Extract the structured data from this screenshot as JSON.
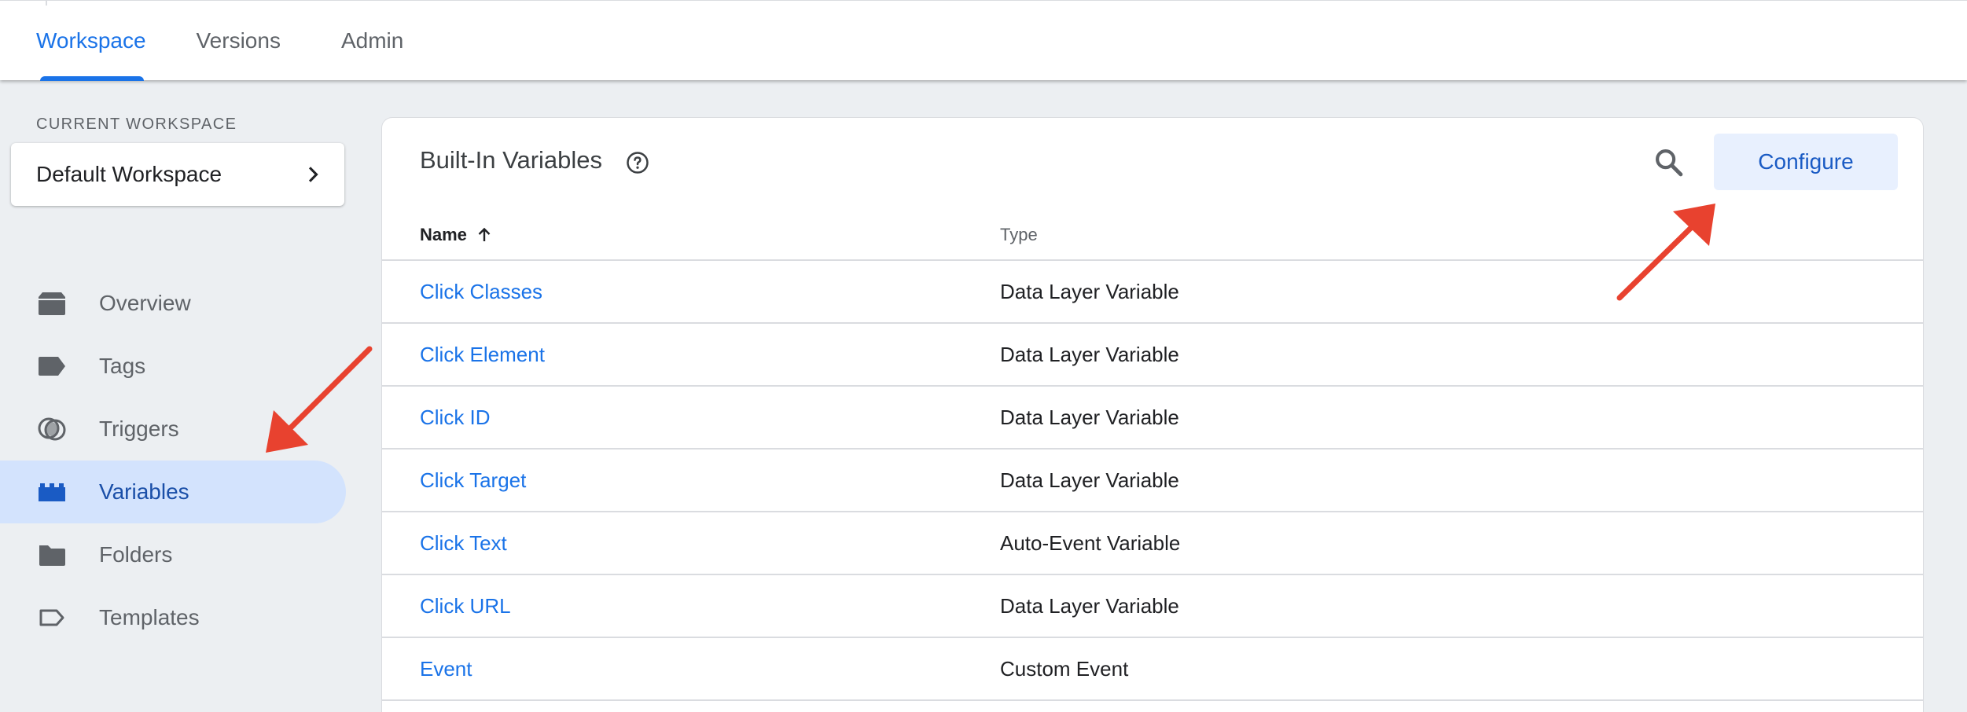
{
  "tabs": [
    {
      "label": "Workspace",
      "active": true
    },
    {
      "label": "Versions",
      "active": false
    },
    {
      "label": "Admin",
      "active": false
    }
  ],
  "sidebar": {
    "current_workspace_label": "CURRENT WORKSPACE",
    "workspace_name": "Default Workspace",
    "nav": [
      {
        "label": "Overview",
        "icon": "overview-icon",
        "active": false
      },
      {
        "label": "Tags",
        "icon": "tag-icon",
        "active": false
      },
      {
        "label": "Triggers",
        "icon": "triggers-icon",
        "active": false
      },
      {
        "label": "Variables",
        "icon": "variables-icon",
        "active": true
      },
      {
        "label": "Folders",
        "icon": "folder-icon",
        "active": false
      },
      {
        "label": "Templates",
        "icon": "templates-icon",
        "active": false
      }
    ]
  },
  "main": {
    "title": "Built-In Variables",
    "configure_label": "Configure",
    "columns": {
      "name": "Name",
      "type": "Type"
    },
    "rows": [
      {
        "name": "Click Classes",
        "type": "Data Layer Variable"
      },
      {
        "name": "Click Element",
        "type": "Data Layer Variable"
      },
      {
        "name": "Click ID",
        "type": "Data Layer Variable"
      },
      {
        "name": "Click Target",
        "type": "Data Layer Variable"
      },
      {
        "name": "Click Text",
        "type": "Auto-Event Variable"
      },
      {
        "name": "Click URL",
        "type": "Data Layer Variable"
      },
      {
        "name": "Event",
        "type": "Custom Event"
      }
    ]
  },
  "colors": {
    "accent": "#1a73e8",
    "active_nav_bg": "#d3e3fd",
    "annotation_arrow": "#e8422f"
  }
}
